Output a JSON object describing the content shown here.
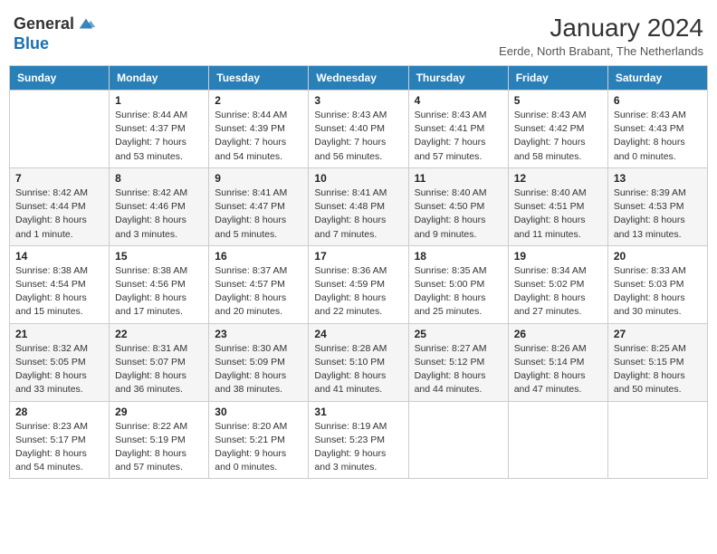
{
  "header": {
    "logo_line1": "General",
    "logo_line2": "Blue",
    "month_year": "January 2024",
    "location": "Eerde, North Brabant, The Netherlands"
  },
  "days_of_week": [
    "Sunday",
    "Monday",
    "Tuesday",
    "Wednesday",
    "Thursday",
    "Friday",
    "Saturday"
  ],
  "weeks": [
    [
      {
        "day": "",
        "info": ""
      },
      {
        "day": "1",
        "info": "Sunrise: 8:44 AM\nSunset: 4:37 PM\nDaylight: 7 hours\nand 53 minutes."
      },
      {
        "day": "2",
        "info": "Sunrise: 8:44 AM\nSunset: 4:39 PM\nDaylight: 7 hours\nand 54 minutes."
      },
      {
        "day": "3",
        "info": "Sunrise: 8:43 AM\nSunset: 4:40 PM\nDaylight: 7 hours\nand 56 minutes."
      },
      {
        "day": "4",
        "info": "Sunrise: 8:43 AM\nSunset: 4:41 PM\nDaylight: 7 hours\nand 57 minutes."
      },
      {
        "day": "5",
        "info": "Sunrise: 8:43 AM\nSunset: 4:42 PM\nDaylight: 7 hours\nand 58 minutes."
      },
      {
        "day": "6",
        "info": "Sunrise: 8:43 AM\nSunset: 4:43 PM\nDaylight: 8 hours\nand 0 minutes."
      }
    ],
    [
      {
        "day": "7",
        "info": "Sunrise: 8:42 AM\nSunset: 4:44 PM\nDaylight: 8 hours\nand 1 minute."
      },
      {
        "day": "8",
        "info": "Sunrise: 8:42 AM\nSunset: 4:46 PM\nDaylight: 8 hours\nand 3 minutes."
      },
      {
        "day": "9",
        "info": "Sunrise: 8:41 AM\nSunset: 4:47 PM\nDaylight: 8 hours\nand 5 minutes."
      },
      {
        "day": "10",
        "info": "Sunrise: 8:41 AM\nSunset: 4:48 PM\nDaylight: 8 hours\nand 7 minutes."
      },
      {
        "day": "11",
        "info": "Sunrise: 8:40 AM\nSunset: 4:50 PM\nDaylight: 8 hours\nand 9 minutes."
      },
      {
        "day": "12",
        "info": "Sunrise: 8:40 AM\nSunset: 4:51 PM\nDaylight: 8 hours\nand 11 minutes."
      },
      {
        "day": "13",
        "info": "Sunrise: 8:39 AM\nSunset: 4:53 PM\nDaylight: 8 hours\nand 13 minutes."
      }
    ],
    [
      {
        "day": "14",
        "info": "Sunrise: 8:38 AM\nSunset: 4:54 PM\nDaylight: 8 hours\nand 15 minutes."
      },
      {
        "day": "15",
        "info": "Sunrise: 8:38 AM\nSunset: 4:56 PM\nDaylight: 8 hours\nand 17 minutes."
      },
      {
        "day": "16",
        "info": "Sunrise: 8:37 AM\nSunset: 4:57 PM\nDaylight: 8 hours\nand 20 minutes."
      },
      {
        "day": "17",
        "info": "Sunrise: 8:36 AM\nSunset: 4:59 PM\nDaylight: 8 hours\nand 22 minutes."
      },
      {
        "day": "18",
        "info": "Sunrise: 8:35 AM\nSunset: 5:00 PM\nDaylight: 8 hours\nand 25 minutes."
      },
      {
        "day": "19",
        "info": "Sunrise: 8:34 AM\nSunset: 5:02 PM\nDaylight: 8 hours\nand 27 minutes."
      },
      {
        "day": "20",
        "info": "Sunrise: 8:33 AM\nSunset: 5:03 PM\nDaylight: 8 hours\nand 30 minutes."
      }
    ],
    [
      {
        "day": "21",
        "info": "Sunrise: 8:32 AM\nSunset: 5:05 PM\nDaylight: 8 hours\nand 33 minutes."
      },
      {
        "day": "22",
        "info": "Sunrise: 8:31 AM\nSunset: 5:07 PM\nDaylight: 8 hours\nand 36 minutes."
      },
      {
        "day": "23",
        "info": "Sunrise: 8:30 AM\nSunset: 5:09 PM\nDaylight: 8 hours\nand 38 minutes."
      },
      {
        "day": "24",
        "info": "Sunrise: 8:28 AM\nSunset: 5:10 PM\nDaylight: 8 hours\nand 41 minutes."
      },
      {
        "day": "25",
        "info": "Sunrise: 8:27 AM\nSunset: 5:12 PM\nDaylight: 8 hours\nand 44 minutes."
      },
      {
        "day": "26",
        "info": "Sunrise: 8:26 AM\nSunset: 5:14 PM\nDaylight: 8 hours\nand 47 minutes."
      },
      {
        "day": "27",
        "info": "Sunrise: 8:25 AM\nSunset: 5:15 PM\nDaylight: 8 hours\nand 50 minutes."
      }
    ],
    [
      {
        "day": "28",
        "info": "Sunrise: 8:23 AM\nSunset: 5:17 PM\nDaylight: 8 hours\nand 54 minutes."
      },
      {
        "day": "29",
        "info": "Sunrise: 8:22 AM\nSunset: 5:19 PM\nDaylight: 8 hours\nand 57 minutes."
      },
      {
        "day": "30",
        "info": "Sunrise: 8:20 AM\nSunset: 5:21 PM\nDaylight: 9 hours\nand 0 minutes."
      },
      {
        "day": "31",
        "info": "Sunrise: 8:19 AM\nSunset: 5:23 PM\nDaylight: 9 hours\nand 3 minutes."
      },
      {
        "day": "",
        "info": ""
      },
      {
        "day": "",
        "info": ""
      },
      {
        "day": "",
        "info": ""
      }
    ]
  ]
}
